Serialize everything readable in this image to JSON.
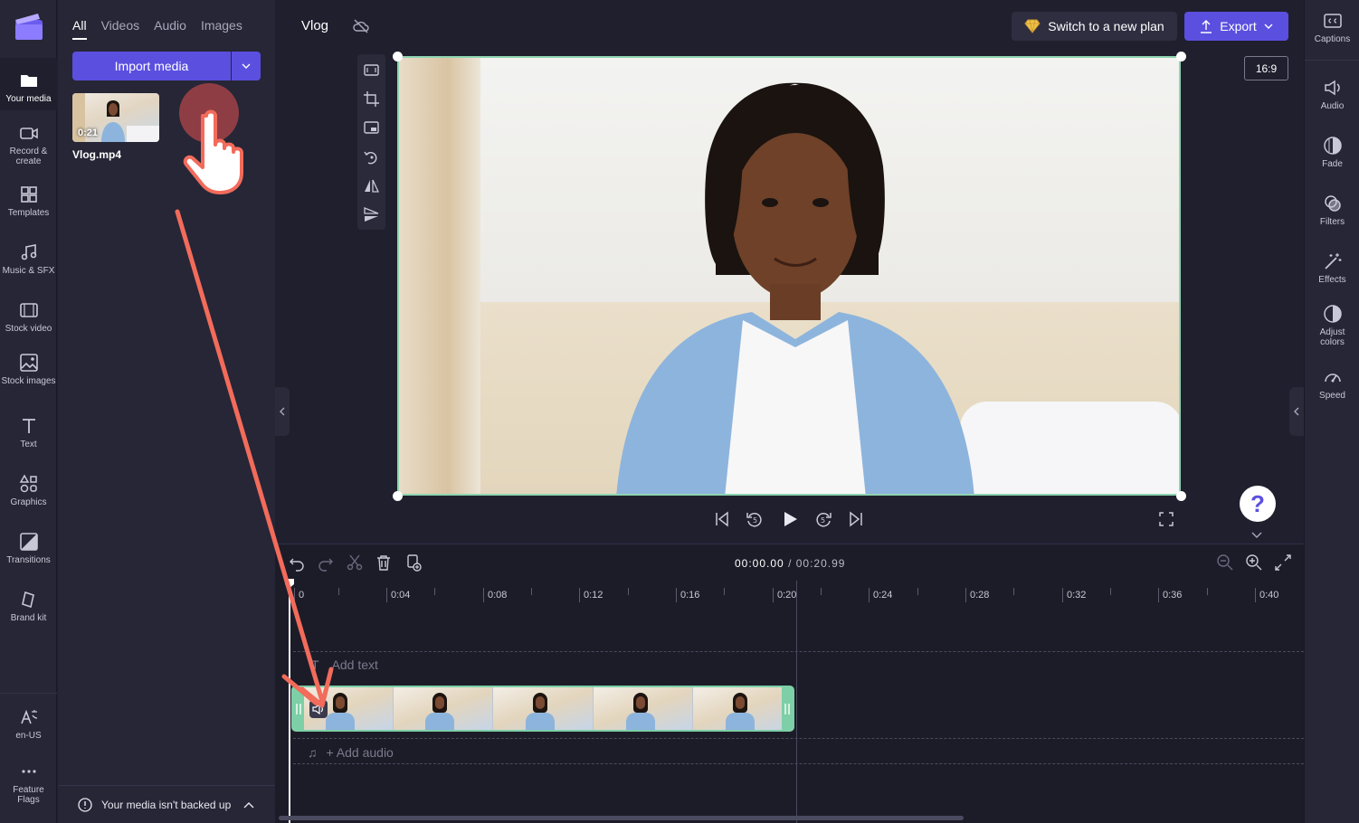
{
  "rail": {
    "items": [
      {
        "label": "Your media",
        "icon": "folder-icon"
      },
      {
        "label": "Record & create",
        "icon": "camera-icon"
      },
      {
        "label": "Templates",
        "icon": "templates-icon"
      },
      {
        "label": "Music & SFX",
        "icon": "music-icon"
      },
      {
        "label": "Stock video",
        "icon": "film-icon"
      },
      {
        "label": "Stock images",
        "icon": "image-icon"
      },
      {
        "label": "Text",
        "icon": "text-icon"
      },
      {
        "label": "Graphics",
        "icon": "shapes-icon"
      },
      {
        "label": "Transitions",
        "icon": "transition-icon"
      },
      {
        "label": "Brand kit",
        "icon": "brand-kit-icon"
      }
    ],
    "bottom": [
      {
        "label": "en-US",
        "icon": "language-icon"
      },
      {
        "label": "Feature Flags",
        "icon": "more-icon"
      }
    ]
  },
  "media_panel": {
    "tabs": [
      "All",
      "Videos",
      "Audio",
      "Images"
    ],
    "import_label": "Import media",
    "asset": {
      "duration": "0:21",
      "name": "Vlog.mp4"
    },
    "backup_notice": "Your media isn't backed up"
  },
  "header": {
    "project_title": "Vlog",
    "plan_label": "Switch to a new plan",
    "export_label": "Export"
  },
  "preview": {
    "aspect_ratio": "16:9"
  },
  "timeline": {
    "current_time": "00:00.00",
    "total_time": "/ 00:20.99",
    "ticks": [
      "0",
      "0:04",
      "0:08",
      "0:12",
      "0:16",
      "0:20",
      "0:24",
      "0:28",
      "0:32",
      "0:36",
      "0:40"
    ],
    "add_text": "Add text",
    "add_audio": "+ Add audio"
  },
  "right_rail": {
    "items": [
      {
        "label": "Captions",
        "icon": "captions-icon"
      },
      {
        "label": "Audio",
        "icon": "speaker-icon"
      },
      {
        "label": "Fade",
        "icon": "fade-icon"
      },
      {
        "label": "Filters",
        "icon": "filters-icon"
      },
      {
        "label": "Effects",
        "icon": "magic-wand-icon"
      },
      {
        "label": "Adjust colors",
        "icon": "contrast-icon"
      },
      {
        "label": "Speed",
        "icon": "speedometer-icon"
      }
    ]
  },
  "colors": {
    "accent": "#5b4fe0",
    "clip_border": "#7ccfa6",
    "annotation": "#f26b5b"
  }
}
